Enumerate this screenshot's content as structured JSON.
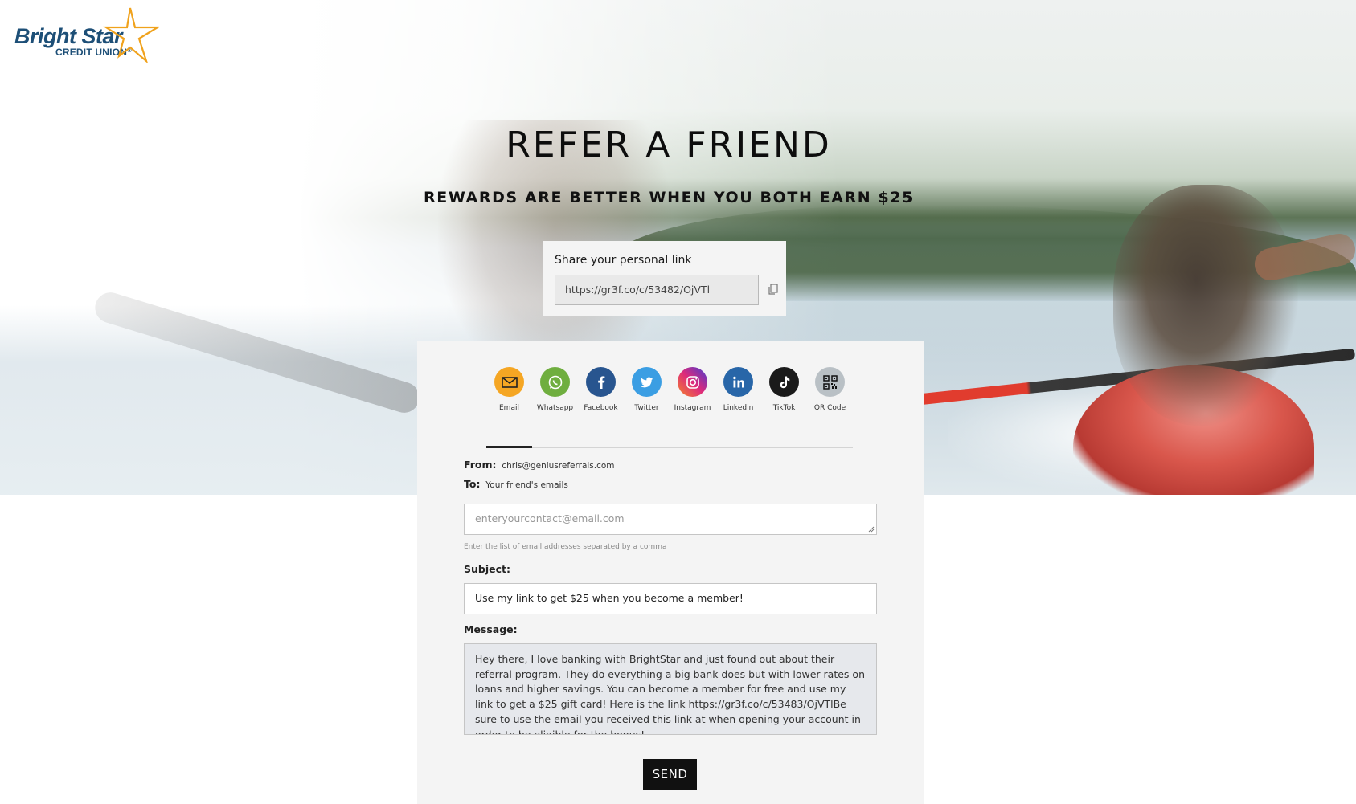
{
  "brand": {
    "name": "Bright Star",
    "subname": "CREDIT UNION",
    "registered_mark": "®",
    "colors": {
      "navy": "#1d4f77",
      "gold": "#f0a21c"
    }
  },
  "hero": {
    "title": "REFER A FRIEND",
    "subtitle": "REWARDS ARE BETTER WHEN YOU BOTH EARN $25"
  },
  "share": {
    "label": "Share your personal link",
    "link": "https://gr3f.co/c/53482/OjVTl",
    "copy_icon": "copy-icon"
  },
  "tabs": [
    {
      "label": "Email",
      "icon": "email-icon",
      "color": "#f5a623",
      "active": true
    },
    {
      "label": "Whatsapp",
      "icon": "whatsapp-icon",
      "color": "#6fae3f",
      "active": false
    },
    {
      "label": "Facebook",
      "icon": "facebook-icon",
      "color": "#28558f",
      "active": false
    },
    {
      "label": "Twitter",
      "icon": "twitter-icon",
      "color": "#3b9ee3",
      "active": false
    },
    {
      "label": "Instagram",
      "icon": "instagram-icon",
      "color": "#c13584",
      "active": false
    },
    {
      "label": "Linkedin",
      "icon": "linkedin-icon",
      "color": "#2866a8",
      "active": false
    },
    {
      "label": "TikTok",
      "icon": "tiktok-icon",
      "color": "#1a1a1a",
      "active": false
    },
    {
      "label": "QR Code",
      "icon": "qr-code-icon",
      "color": "#b9c0c5",
      "active": false
    }
  ],
  "form": {
    "from_label": "From:",
    "from_value": "chris@geniusreferrals.com",
    "to_label": "To:",
    "to_value": "Your friend's emails",
    "to_placeholder": "enteryourcontact@email.com",
    "to_hint": "Enter the list of email addresses separated by a comma",
    "subject_label": "Subject:",
    "subject_value": "Use my link to get $25 when you become a member!",
    "message_label": "Message:",
    "message_value": "Hey there, I love banking with BrightStar and just found out about their referral program. They do everything a big bank does but with lower rates on loans and higher savings. You can become a member for free and use my link to get a $25 gift card! Here is the link https://gr3f.co/c/53483/OjVTlBe sure to use the email you received this link at when opening your account in order to be eligible for the bonus!",
    "send_label": "SEND"
  }
}
